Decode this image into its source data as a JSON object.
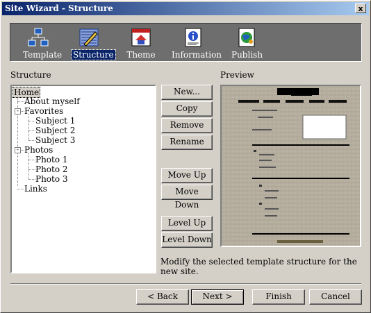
{
  "window": {
    "title": "Site Wizard - Structure",
    "close_glyph": "x"
  },
  "toolbar": {
    "steps": [
      {
        "label": "Template",
        "icon": "sitemap-icon"
      },
      {
        "label": "Structure",
        "icon": "structure-pencil-icon",
        "selected": true
      },
      {
        "label": "Theme",
        "icon": "theme-window-icon"
      },
      {
        "label": "Information",
        "icon": "information-icon"
      },
      {
        "label": "Publish",
        "icon": "publish-globe-icon"
      }
    ]
  },
  "structure": {
    "heading": "Structure",
    "tree": [
      {
        "label": "Home",
        "level": 0,
        "selected": true
      },
      {
        "label": "About myself",
        "level": 1
      },
      {
        "label": "Favorites",
        "level": 1,
        "expanded": true
      },
      {
        "label": "Subject 1",
        "level": 2
      },
      {
        "label": "Subject 2",
        "level": 2
      },
      {
        "label": "Subject 3",
        "level": 2
      },
      {
        "label": "Photos",
        "level": 1,
        "expanded": true
      },
      {
        "label": "Photo 1",
        "level": 2
      },
      {
        "label": "Photo 2",
        "level": 2
      },
      {
        "label": "Photo 3",
        "level": 2
      },
      {
        "label": "Links",
        "level": 1
      }
    ]
  },
  "buttons": {
    "new": "New...",
    "copy": "Copy",
    "remove": "Remove",
    "rename": "Rename",
    "move_up": "Move Up",
    "move_down": "Move Down",
    "level_up": "Level Up",
    "level_down": "Level Down"
  },
  "preview": {
    "heading": "Preview"
  },
  "description": "Modify the selected template structure for the new site.",
  "footer": {
    "back": "< Back",
    "next": "Next >",
    "finish": "Finish",
    "cancel": "Cancel"
  },
  "colors": {
    "titlebar_start": "#0a246a",
    "titlebar_end": "#a6caf0",
    "toolbar_bg": "#6e6e6e",
    "selection": "#0a246a"
  }
}
